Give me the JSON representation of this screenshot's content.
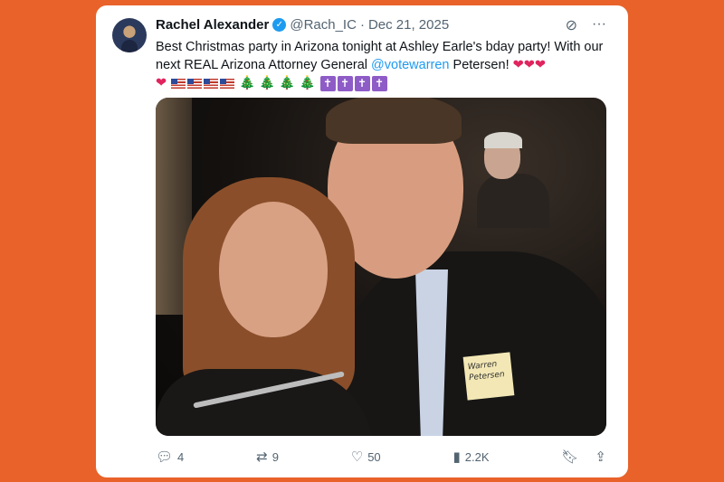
{
  "tweet": {
    "author_name": "Rachel Alexander",
    "handle": "@Rach_IC",
    "separator": "·",
    "date": "Dec 21, 2025",
    "text_part1": "Best Christmas party in Arizona tonight at Ashley Earle's bday party! With our next REAL Arizona Attorney General ",
    "mention": "@votewarren",
    "text_part2": " Petersen!",
    "hearts": "❤❤❤",
    "heart2": "❤",
    "trees": "🎄 🎄 🎄 🎄",
    "crosses": [
      "✝",
      "✝",
      "✝",
      "✝"
    ]
  },
  "photo": {
    "name_tag": "Warren Petersen"
  },
  "actions": {
    "replies": "4",
    "retweets": "9",
    "likes": "50",
    "views": "2.2K"
  },
  "colors": {
    "background": "#e8622a",
    "accent": "#1d9bf0",
    "text": "#0f1419",
    "muted": "#536471"
  },
  "icons": [
    "verified-icon",
    "grok-icon",
    "more-icon",
    "reply-icon",
    "retweet-icon",
    "like-icon",
    "views-icon",
    "bookmark-icon",
    "share-icon"
  ]
}
